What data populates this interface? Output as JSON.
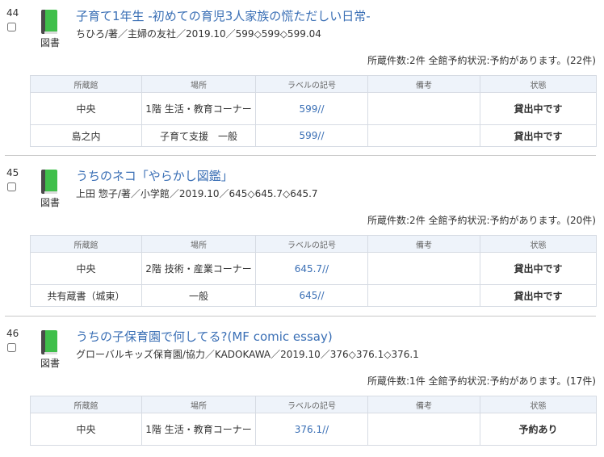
{
  "entries": [
    {
      "number": "44",
      "type_label": "図書",
      "title": "子育て1年生 -初めての育児3人家族の慌ただしい日常-",
      "meta": "ちひろ/著／主婦の友社／2019.10／599◇599◇599.04",
      "status": "所蔵件数:2件 全館予約状況:予約があります。(22件)",
      "headers": [
        "所蔵館",
        "場所",
        "ラベルの記号",
        "備考",
        "状態"
      ],
      "rows": [
        {
          "library": "中央",
          "location": "1階 生活・教育コーナー",
          "label": "599//",
          "note": "",
          "state": "貸出中です"
        },
        {
          "library": "島之内",
          "location": "子育て支援　一般",
          "label": "599//",
          "note": "",
          "state": "貸出中です"
        }
      ]
    },
    {
      "number": "45",
      "type_label": "図書",
      "title": "うちのネコ「やらかし図鑑」",
      "meta": "上田 惣子/著／小学館／2019.10／645◇645.7◇645.7",
      "status": "所蔵件数:2件 全館予約状況:予約があります。(20件)",
      "headers": [
        "所蔵館",
        "場所",
        "ラベルの記号",
        "備考",
        "状態"
      ],
      "rows": [
        {
          "library": "中央",
          "location": "2階 技術・産業コーナー",
          "label": "645.7//",
          "note": "",
          "state": "貸出中です"
        },
        {
          "library": "共有蔵書（城東）",
          "location": "一般",
          "label": "645//",
          "note": "",
          "state": "貸出中です"
        }
      ]
    },
    {
      "number": "46",
      "type_label": "図書",
      "title": "うちの子保育園で何してる?(MF comic essay)",
      "meta": "グローバルキッズ保育園/協力／KADOKAWA／2019.10／376◇376.1◇376.1",
      "status": "所蔵件数:1件 全館予約状況:予約があります。(17件)",
      "headers": [
        "所蔵館",
        "場所",
        "ラベルの記号",
        "備考",
        "状態"
      ],
      "rows": [
        {
          "library": "中央",
          "location": "1階 生活・教育コーナー",
          "label": "376.1//",
          "note": "",
          "state": "予約あり"
        }
      ]
    }
  ],
  "colors": {
    "link": "#3a6fb5",
    "book_green": "#3fbf4a",
    "header_bg": "#eef3fa"
  }
}
